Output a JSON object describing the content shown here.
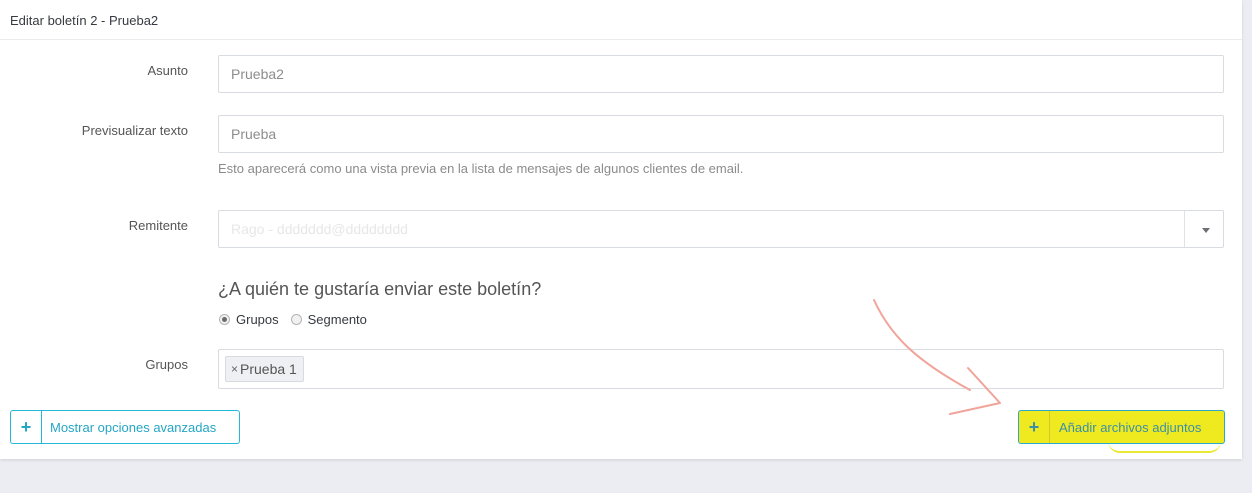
{
  "panel": {
    "title": "Editar boletín 2 - Prueba2"
  },
  "form": {
    "subject": {
      "label": "Asunto",
      "value": "Prueba2"
    },
    "preview": {
      "label": "Previsualizar texto",
      "value": "Prueba",
      "help": "Esto aparecerá como una vista previa en la lista de mensajes de algunos clientes de email."
    },
    "sender": {
      "label": "Remitente",
      "value": "Rago - ddddddd@dddddddd"
    },
    "recipients_question": "¿A quién te gustaría enviar este boletín?",
    "recipient_options": [
      {
        "label": "Grupos",
        "selected": true
      },
      {
        "label": "Segmento",
        "selected": false
      }
    ],
    "groups": {
      "label": "Grupos",
      "tags": [
        "Prueba 1"
      ],
      "remove_glyph": "×"
    }
  },
  "buttons": {
    "advanced": {
      "icon": "plus-icon",
      "glyph": "+",
      "label": "Mostrar opciones avanzadas"
    },
    "attachments": {
      "icon": "plus-icon",
      "glyph": "+",
      "label": "Añadir archivos adjuntos"
    }
  },
  "colors": {
    "accent": "#25b9d7",
    "highlight": "#eeea1f",
    "annotation_arrow": "#f0a49a"
  }
}
